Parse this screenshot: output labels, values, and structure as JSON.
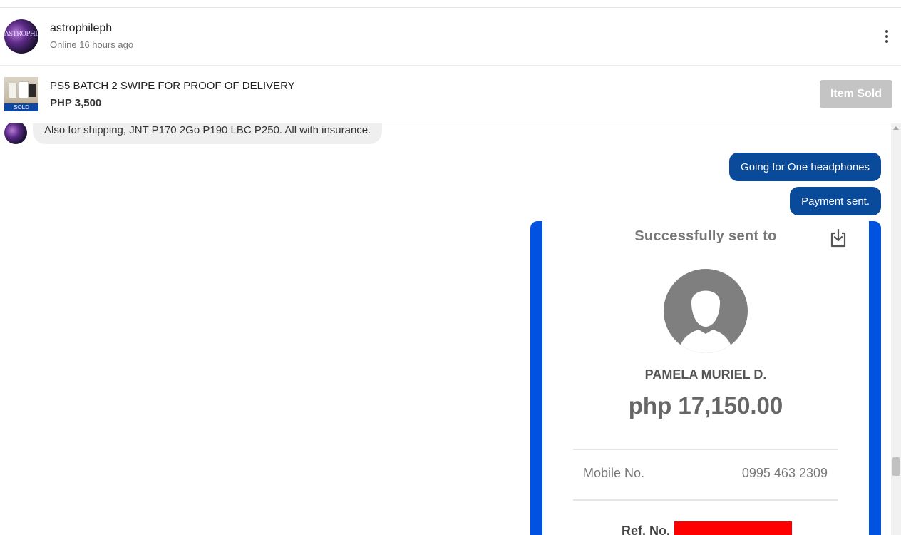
{
  "seller": {
    "avatar_text": "ASTROPHILE",
    "name": "astrophileph",
    "status": "Online 16 hours ago"
  },
  "listing": {
    "thumb_badge": "SOLD",
    "title": "PS5 BATCH 2 SWIPE FOR PROOF OF DELIVERY",
    "price": "PHP 3,500",
    "status_button": "Item Sold"
  },
  "messages": {
    "incoming": [
      {
        "text": "Also for shipping, JNT P170 2Go P190 LBC P250. All with insurance."
      }
    ],
    "outgoing": [
      {
        "text": "Going for One headphones"
      },
      {
        "text": "Payment sent."
      }
    ]
  },
  "receipt": {
    "title": "Successfully sent to",
    "recipient_name": "PAMELA MURIEL D.",
    "amount": "php 17,150.00",
    "mobile_label": "Mobile No.",
    "mobile_value": "0995 463 2309",
    "ref_label": "Ref. No."
  },
  "colors": {
    "outgoing_bubble": "#0a4a9a",
    "incoming_bubble": "#efefef",
    "receipt_border": "#0052e0",
    "sold_button": "#c4c4c4",
    "redaction": "#ff0000"
  },
  "icons": {
    "menu": "more-vertical-icon",
    "download": "download-icon",
    "recipient": "person-placeholder-icon"
  }
}
